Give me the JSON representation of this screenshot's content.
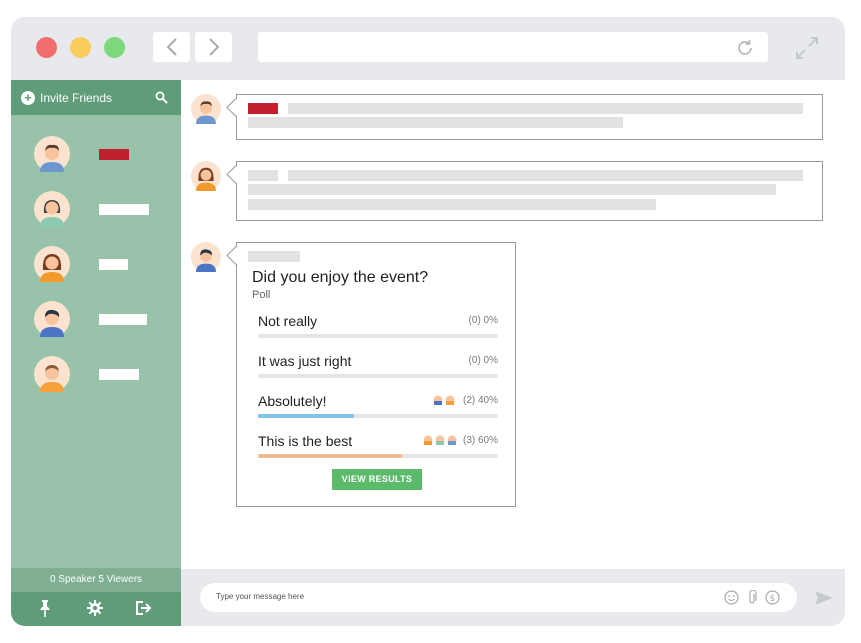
{
  "colors": {
    "close": "#f26d6d",
    "minimize": "#f9cd5b",
    "zoom": "#7bd87b",
    "sidebar": "#98c3aa",
    "sidebar_header": "#5f9c7a",
    "accent_button": "#5cba6b",
    "bar_absolutely": "#7cc6e6",
    "bar_best": "#efb88d"
  },
  "browser": {
    "back_icon": "chevron-left-icon",
    "forward_icon": "chevron-right-icon",
    "reload_icon": "reload-icon",
    "expand_icon": "expand-icon"
  },
  "sidebar": {
    "invite_label": "Invite Friends",
    "footer_status": "0 Speaker 5 Viewers",
    "tools": [
      "pin-icon",
      "gear-icon",
      "exit-icon"
    ]
  },
  "poll": {
    "question": "Did you enjoy the event?",
    "subtitle": "Poll",
    "options": [
      {
        "label": "Not really",
        "stat": "(0) 0%",
        "fraction": 0
      },
      {
        "label": "It was just right",
        "stat": "(0) 0%",
        "fraction": 0
      },
      {
        "label": "Absolutely!",
        "stat": "(2) 40%",
        "fraction": 0.4
      },
      {
        "label": "This is the best",
        "stat": "(3) 60%",
        "fraction": 0.6
      }
    ],
    "button_label": "VIEW RESULTS"
  },
  "composer": {
    "placeholder": "Type your message here",
    "icons": [
      "emoji-icon",
      "attachment-icon",
      "dollar-icon",
      "send-icon"
    ]
  }
}
